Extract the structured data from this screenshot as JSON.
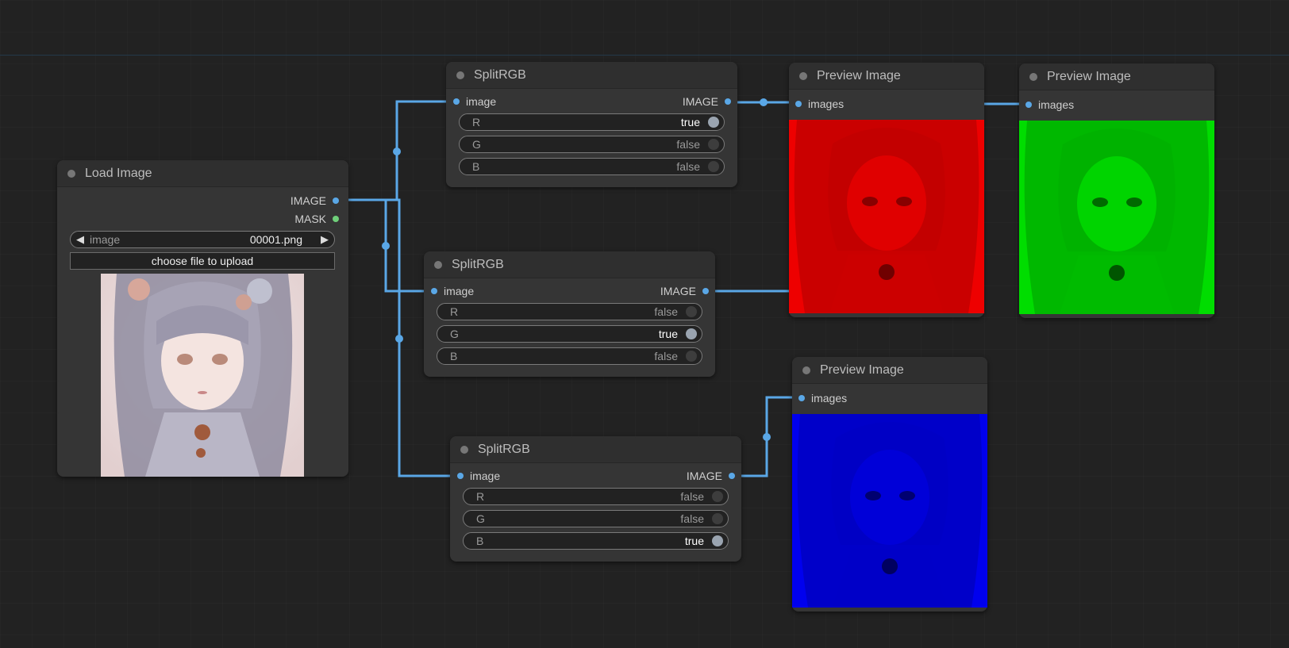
{
  "nodes": {
    "load_image": {
      "title": "Load Image",
      "outputs": [
        "IMAGE",
        "MASK"
      ],
      "image_widget": {
        "label": "image",
        "value": "00001.png"
      },
      "upload_button": "choose file to upload"
    },
    "split1": {
      "title": "SplitRGB",
      "input": "image",
      "output": "IMAGE",
      "toggles": [
        {
          "label": "R",
          "value": "true"
        },
        {
          "label": "G",
          "value": "false"
        },
        {
          "label": "B",
          "value": "false"
        }
      ]
    },
    "split2": {
      "title": "SplitRGB",
      "input": "image",
      "output": "IMAGE",
      "toggles": [
        {
          "label": "R",
          "value": "false"
        },
        {
          "label": "G",
          "value": "true"
        },
        {
          "label": "B",
          "value": "false"
        }
      ]
    },
    "split3": {
      "title": "SplitRGB",
      "input": "image",
      "output": "IMAGE",
      "toggles": [
        {
          "label": "R",
          "value": "false"
        },
        {
          "label": "G",
          "value": "false"
        },
        {
          "label": "B",
          "value": "true"
        }
      ]
    },
    "preview_red": {
      "title": "Preview Image",
      "input": "images"
    },
    "preview_green": {
      "title": "Preview Image",
      "input": "images"
    },
    "preview_blue": {
      "title": "Preview Image",
      "input": "images"
    }
  },
  "colors": {
    "link": "#5aa7e6",
    "canvas": "#222222",
    "node_body": "#353535",
    "red_channel": "#ee0000",
    "green_channel": "#00dd00",
    "blue_channel": "#0000ee"
  }
}
